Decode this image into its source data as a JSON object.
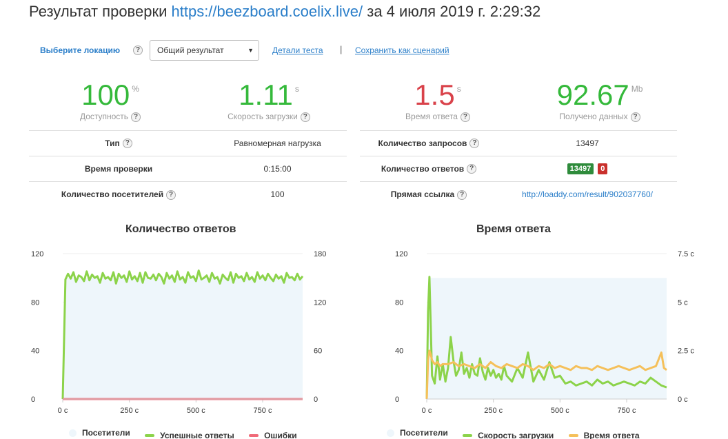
{
  "header": {
    "title_prefix": "Результат проверки",
    "url": "https://beezboard.coelix.live/",
    "title_suffix": "за 4 июля 2019 г. 2:29:32"
  },
  "toolbar": {
    "location_label": "Выберите локацию",
    "help": "?",
    "select_value": "Общий результат",
    "details_link": "Детали теста",
    "separator": "|",
    "save_link": "Сохранить как сценарий"
  },
  "metrics": [
    {
      "value": "100",
      "unit": "%",
      "caption": "Доступность",
      "color": "#35b93b"
    },
    {
      "value": "1.11",
      "unit": "s",
      "caption": "Скорость загрузки",
      "color": "#35b93b"
    },
    {
      "value": "1.5",
      "unit": "s",
      "caption": "Время ответа",
      "color": "#d9424a"
    },
    {
      "value": "92.67",
      "unit": "Mb",
      "caption": "Получено данных",
      "color": "#35b93b"
    }
  ],
  "left_table": [
    {
      "key": "Тип",
      "value": "Равномерная нагрузка"
    },
    {
      "key": "Время проверки",
      "value": "0:15:00"
    },
    {
      "key": "Количество посетителей",
      "value": "100"
    }
  ],
  "right_table": {
    "requests_label": "Количество запросов",
    "requests_value": "13497",
    "responses_label": "Количество ответов",
    "responses_ok": "13497",
    "responses_err": "0",
    "link_label": "Прямая ссылка",
    "link_value": "http://loaddy.com/result/902037760/"
  },
  "chart_data": [
    {
      "type": "line",
      "title": "Количество ответов",
      "x_ticks": [
        "0 с",
        "250 с",
        "500 с",
        "750 с"
      ],
      "y_left_ticks": [
        "0",
        "40",
        "80",
        "120"
      ],
      "y_right_ticks": [
        "0",
        "60",
        "120",
        "180"
      ],
      "ylim_left": [
        0,
        120
      ],
      "ylim_right": [
        0,
        180
      ],
      "xlim": [
        0,
        900
      ],
      "legend": [
        "Посетители",
        "Успешные ответы",
        "Ошибки"
      ],
      "colors": {
        "visitors": "#eef6fb",
        "success": "#8cd34a",
        "errors": "#f06a78"
      },
      "series": [
        {
          "name": "Посетители",
          "axis": "left",
          "x": [
            0,
            10,
            900
          ],
          "y": [
            0,
            100,
            100
          ]
        },
        {
          "name": "Успешные ответы",
          "axis": "right",
          "x": [
            0,
            10,
            20,
            30,
            40,
            50,
            60,
            70,
            80,
            90,
            100,
            110,
            120,
            130,
            140,
            150,
            160,
            170,
            180,
            190,
            200,
            210,
            220,
            230,
            240,
            250,
            260,
            270,
            280,
            290,
            300,
            310,
            320,
            330,
            340,
            350,
            360,
            370,
            380,
            390,
            400,
            410,
            420,
            430,
            440,
            450,
            460,
            470,
            480,
            490,
            500,
            510,
            520,
            530,
            540,
            550,
            560,
            570,
            580,
            590,
            600,
            610,
            620,
            630,
            640,
            650,
            660,
            670,
            680,
            690,
            700,
            710,
            720,
            730,
            740,
            750,
            760,
            770,
            780,
            790,
            800,
            810,
            820,
            830,
            840,
            850,
            860,
            870,
            880,
            890,
            900
          ],
          "y": [
            0,
            148,
            155,
            149,
            157,
            145,
            153,
            151,
            146,
            158,
            147,
            154,
            150,
            152,
            144,
            156,
            149,
            151,
            147,
            157,
            143,
            155,
            150,
            153,
            145,
            158,
            148,
            152,
            146,
            156,
            144,
            157,
            150,
            149,
            154,
            147,
            155,
            151,
            143,
            156,
            149,
            153,
            145,
            158,
            148,
            151,
            144,
            157,
            150,
            152,
            146,
            159,
            148,
            150,
            153,
            145,
            156,
            149,
            151,
            143,
            154,
            150,
            147,
            157,
            144,
            155,
            150,
            152,
            146,
            156,
            148,
            151,
            145,
            157,
            149,
            153,
            147,
            155,
            150,
            146,
            154,
            149,
            152,
            144,
            156,
            150,
            151,
            147,
            155,
            148,
            152
          ]
        },
        {
          "name": "Ошибки",
          "axis": "right",
          "x": [
            0,
            900
          ],
          "y": [
            0,
            0
          ]
        }
      ]
    },
    {
      "type": "line",
      "title": "Время ответа",
      "x_ticks": [
        "0 с",
        "250 с",
        "500 с",
        "750 с"
      ],
      "y_left_ticks": [
        "0",
        "40",
        "80",
        "120"
      ],
      "y_right_ticks": [
        "0 с",
        "2.5 с",
        "5 с",
        "7.5 с"
      ],
      "ylim_left": [
        0,
        120
      ],
      "ylim_right": [
        0,
        7.5
      ],
      "xlim": [
        0,
        900
      ],
      "legend": [
        "Посетители",
        "Скорость загрузки",
        "Время ответа"
      ],
      "colors": {
        "visitors": "#eef6fb",
        "load": "#8cd34a",
        "response": "#f5c05a"
      },
      "series": [
        {
          "name": "Посетители",
          "axis": "left",
          "x": [
            0,
            10,
            900
          ],
          "y": [
            0,
            100,
            100
          ]
        },
        {
          "name": "Скорость загрузки",
          "axis": "right",
          "x": [
            0,
            5,
            10,
            15,
            20,
            30,
            40,
            50,
            60,
            70,
            80,
            90,
            100,
            110,
            120,
            130,
            140,
            150,
            160,
            170,
            180,
            190,
            200,
            210,
            220,
            230,
            240,
            250,
            260,
            270,
            280,
            290,
            300,
            320,
            340,
            360,
            380,
            400,
            420,
            440,
            460,
            480,
            500,
            520,
            540,
            560,
            580,
            600,
            620,
            640,
            660,
            680,
            700,
            720,
            740,
            760,
            780,
            800,
            820,
            840,
            860,
            880,
            900
          ],
          "y": [
            0,
            4.5,
            6.3,
            3.8,
            1.2,
            0.8,
            2.2,
            1.0,
            1.8,
            0.9,
            1.6,
            3.2,
            2.0,
            1.2,
            1.5,
            2.4,
            1.3,
            1.6,
            1.1,
            1.8,
            1.3,
            1.2,
            2.1,
            1.4,
            1.0,
            1.6,
            1.2,
            1.5,
            1.1,
            1.3,
            1.0,
            1.7,
            1.2,
            0.9,
            1.6,
            1.1,
            2.4,
            0.9,
            1.5,
            1.0,
            1.9,
            1.1,
            1.2,
            0.8,
            0.9,
            0.7,
            0.8,
            0.9,
            0.7,
            1.0,
            0.8,
            0.9,
            0.7,
            0.8,
            0.9,
            0.8,
            0.7,
            0.9,
            0.8,
            1.1,
            0.9,
            0.7,
            0.6
          ]
        },
        {
          "name": "Время ответа",
          "axis": "right",
          "x": [
            0,
            5,
            10,
            15,
            20,
            30,
            40,
            50,
            60,
            80,
            100,
            120,
            140,
            160,
            180,
            200,
            220,
            240,
            260,
            280,
            300,
            320,
            340,
            360,
            380,
            400,
            420,
            440,
            460,
            480,
            500,
            520,
            540,
            560,
            580,
            600,
            620,
            640,
            660,
            680,
            700,
            720,
            740,
            760,
            780,
            800,
            820,
            840,
            860,
            880,
            890,
            900
          ],
          "y": [
            0,
            2.0,
            2.5,
            2.3,
            2.0,
            1.8,
            1.9,
            1.7,
            1.8,
            1.8,
            1.9,
            1.7,
            1.8,
            1.7,
            1.6,
            1.8,
            1.6,
            1.9,
            1.7,
            1.6,
            1.8,
            1.7,
            1.6,
            1.8,
            1.7,
            1.5,
            1.7,
            1.6,
            1.8,
            1.6,
            1.7,
            1.6,
            1.5,
            1.7,
            1.6,
            1.6,
            1.5,
            1.7,
            1.6,
            1.5,
            1.6,
            1.7,
            1.6,
            1.5,
            1.6,
            1.7,
            1.5,
            1.6,
            1.7,
            2.4,
            1.6,
            1.5
          ]
        }
      ]
    }
  ]
}
